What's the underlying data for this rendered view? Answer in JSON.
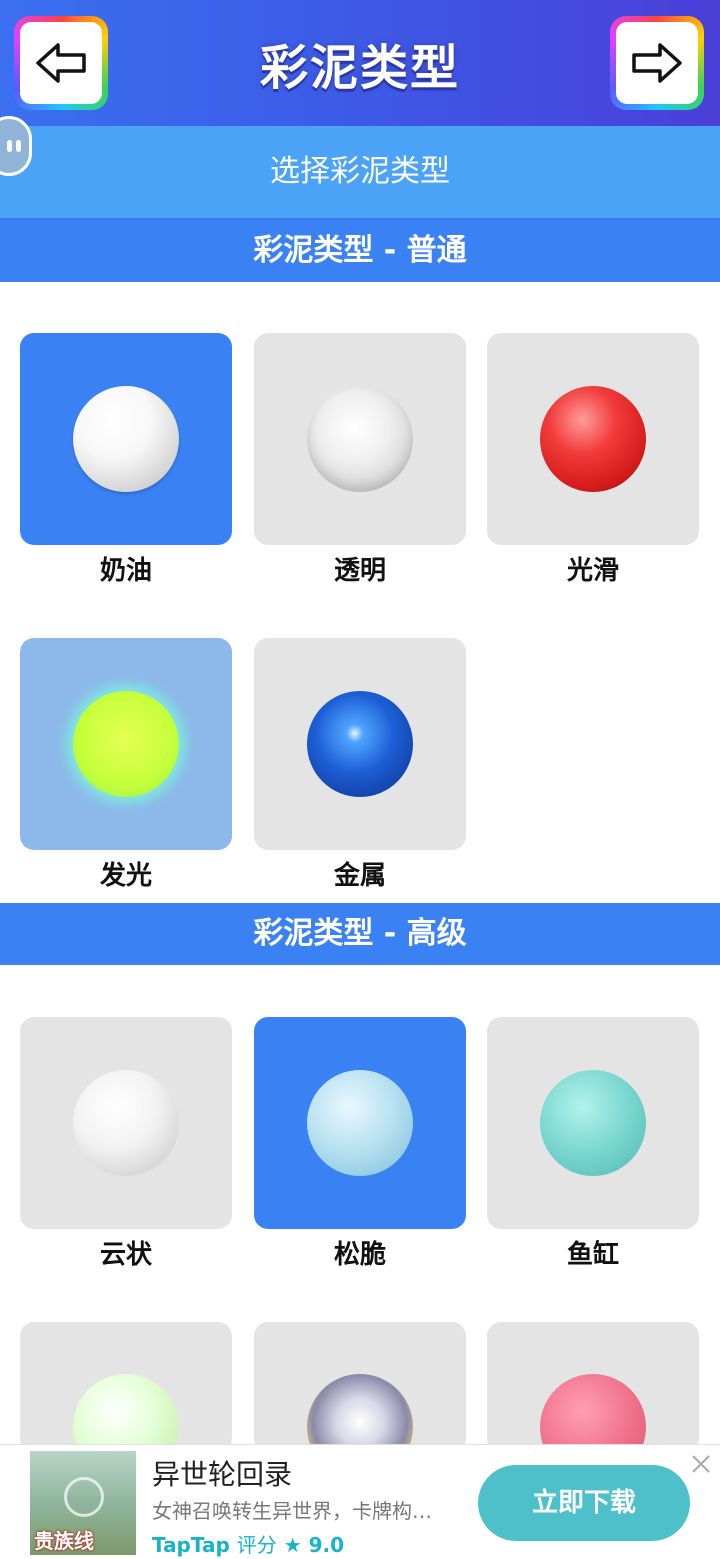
{
  "header": {
    "title": "彩泥类型",
    "back_icon": "arrow-left-icon",
    "next_icon": "arrow-right-icon"
  },
  "subtitle": "选择彩泥类型",
  "sections": [
    {
      "title": "彩泥类型 - 普通",
      "items": [
        {
          "label": "奶油",
          "ball": "cream",
          "state": "selected"
        },
        {
          "label": "透明",
          "ball": "clear",
          "state": "normal"
        },
        {
          "label": "光滑",
          "ball": "smooth",
          "state": "normal"
        },
        {
          "label": "发光",
          "ball": "glow",
          "state": "highlight"
        },
        {
          "label": "金属",
          "ball": "metal",
          "state": "normal"
        }
      ]
    },
    {
      "title": "彩泥类型 - 高级",
      "items": [
        {
          "label": "云状",
          "ball": "cloud",
          "state": "normal"
        },
        {
          "label": "松脆",
          "ball": "crunchy",
          "state": "selected"
        },
        {
          "label": "鱼缸",
          "ball": "fishbowl",
          "state": "normal"
        }
      ]
    }
  ],
  "ad": {
    "title": "异世轮回录",
    "description": "女神召唤转生异世界，卡牌构…",
    "platform": "TapTap",
    "rating_label": "评分",
    "rating_value": "9.0",
    "cta": "立即下载",
    "thumb_text": "贵族线"
  },
  "colors": {
    "header_start": "#3b6ff0",
    "header_end": "#4a3fd8",
    "section_bar": "#3a82f4",
    "subbar": "#4aa3f7",
    "tile": "#e4e4e4",
    "tile_selected": "#3a82f4",
    "ad_button": "#4ec0c9"
  }
}
